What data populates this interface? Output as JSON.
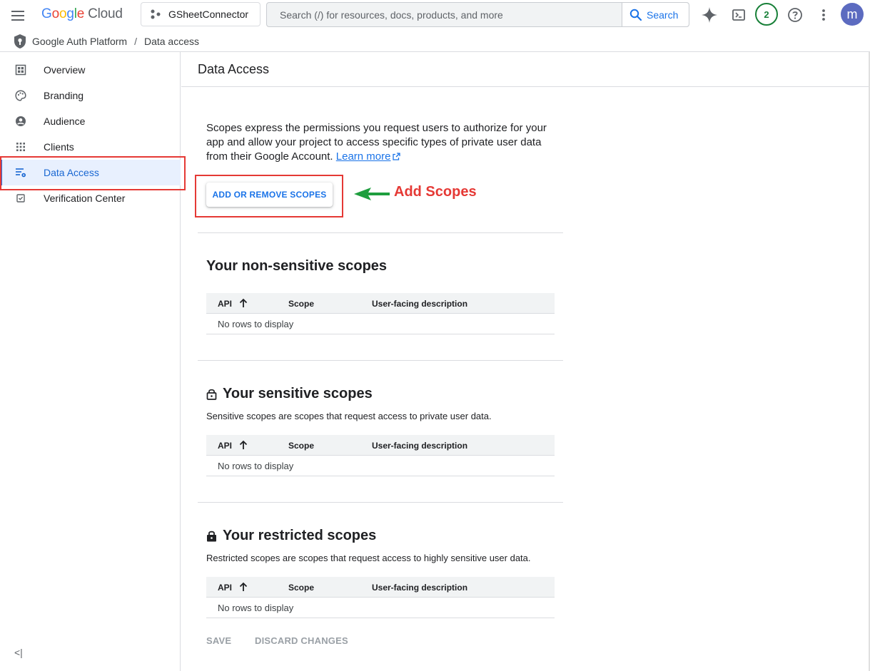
{
  "topbar": {
    "logo_letters": [
      "G",
      "o",
      "o",
      "g",
      "l",
      "e"
    ],
    "logo_product": "Cloud",
    "project_name": "GSheetConnector",
    "search_placeholder": "Search (/) for resources, docs, products, and more",
    "search_label": "Search",
    "notification_count": "2",
    "avatar_letter": "m"
  },
  "breadcrumb": {
    "items": [
      "Google Auth Platform",
      "Data access"
    ],
    "separator": "/"
  },
  "sidebar": {
    "items": [
      {
        "label": "Overview",
        "icon": "dashboard-icon"
      },
      {
        "label": "Branding",
        "icon": "palette-icon"
      },
      {
        "label": "Audience",
        "icon": "account-circle-icon"
      },
      {
        "label": "Clients",
        "icon": "apps-grid-icon"
      },
      {
        "label": "Data Access",
        "icon": "data-access-icon",
        "active": true
      },
      {
        "label": "Verification Center",
        "icon": "checkbox-icon"
      }
    ],
    "collapse_label": "<|"
  },
  "main": {
    "page_title": "Data Access",
    "intro_text": "Scopes express the permissions you request users to authorize for your app and allow your project to access specific types of private user data from their Google Account.",
    "learn_more": "Learn more",
    "add_button": "ADD OR REMOVE SCOPES",
    "annotation": "Add Scopes",
    "table_columns": {
      "api": "API",
      "scope": "Scope",
      "description": "User-facing description"
    },
    "empty_text": "No rows to display",
    "sections": {
      "non_sensitive": {
        "title": "Your non-sensitive scopes"
      },
      "sensitive": {
        "title": "Your sensitive scopes",
        "description": "Sensitive scopes are scopes that request access to private user data."
      },
      "restricted": {
        "title": "Your restricted scopes",
        "description": "Restricted scopes are scopes that request access to highly sensitive user data."
      }
    },
    "footer": {
      "save": "SAVE",
      "discard": "DISCARD CHANGES"
    }
  },
  "colors": {
    "accent": "#1a73e8",
    "active_bg": "#e8f0fe",
    "annotation": "#e53935",
    "arrow": "#1e9e3e",
    "badge": "#188038",
    "avatar": "#5c6bc0"
  }
}
